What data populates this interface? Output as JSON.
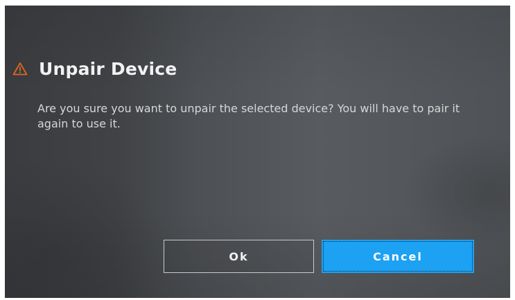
{
  "dialog": {
    "icon": "warning-triangle-icon",
    "title": "Unpair Device",
    "message": "Are you sure you want to unpair the selected device? You will have to pair it again to use it.",
    "ok_label": "Ok",
    "cancel_label": "Cancel"
  },
  "colors": {
    "warning": "#e0661f",
    "primary_button": "#1da1f2"
  }
}
